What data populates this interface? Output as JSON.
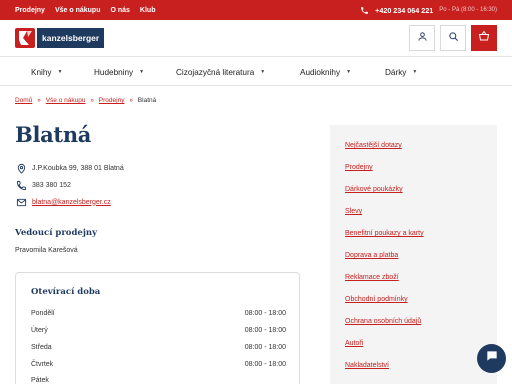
{
  "topbar": {
    "links": [
      "Prodejny",
      "Vše o nákupu",
      "O nás",
      "Klub"
    ],
    "phone": "+420 234 064 221",
    "hours": "Po - Pá (8:00 - 16:30)"
  },
  "header": {
    "logo_text": "kanzelsberger",
    "icons": [
      "user-icon",
      "search-icon",
      "cart-icon"
    ]
  },
  "nav": {
    "items": [
      "Knihy",
      "Hudebniny",
      "Cizojazyčná literatura",
      "Audioknihy",
      "Dárky"
    ]
  },
  "breadcrumb": {
    "home": "Domů",
    "shopping": "Vše o nákupu",
    "stores": "Prodejny",
    "current": "Blatná"
  },
  "store": {
    "title": "Blatná",
    "address": "J.P.Koubka 99, 388 01 Blatná",
    "phone": "383 380 152",
    "email": "blatna@kanzelsberger.cz",
    "head_heading": "Vedoucí prodejny",
    "head_name": "Pravomila Karešová"
  },
  "hours": {
    "title": "Otevírací doba",
    "rows": [
      {
        "day": "Pondělí",
        "time": "08:00 - 18:00"
      },
      {
        "day": "Úterý",
        "time": "08:00 - 18:00"
      },
      {
        "day": "Středa",
        "time": "08:00 - 18:00"
      },
      {
        "day": "Čtvrtek",
        "time": "08:00 - 18:00"
      },
      {
        "day": "Pátek",
        "time": ""
      }
    ]
  },
  "sidebar": {
    "items": [
      "Nejčastější dotazy",
      "Prodejny",
      "Dárkové poukázky",
      "Slevy",
      "Benefitní poukazy a karty",
      "Doprava a platba",
      "Reklamace zboží",
      "Obchodní podmínky",
      "Ochrana osobních údajů",
      "Autoři",
      "Nakladatelství"
    ]
  },
  "colors": {
    "brand_red": "#c8201f",
    "navy": "#1f3a5f",
    "sidebar_bg": "#f4f4f4"
  }
}
